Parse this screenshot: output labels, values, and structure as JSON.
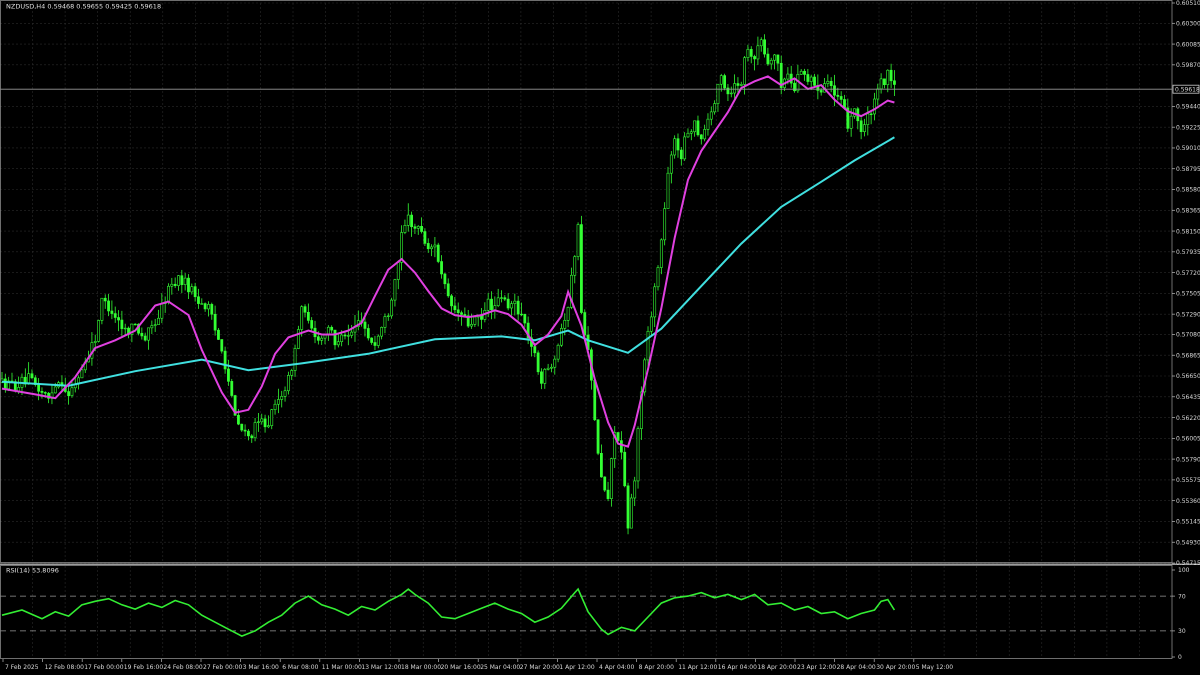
{
  "header": {
    "main_text": "NZDUSD,H4  0.59468 0.59655 0.59425 0.59618",
    "rsi_text": "RSI(14) 53.8096"
  },
  "colors": {
    "background": "#000000",
    "grid": "#2a2a2a",
    "frame": "#8a8a8a",
    "candle": "#33ff33",
    "ma_fast": "#e040e0",
    "ma_slow": "#40e0e0",
    "rsi_line": "#33ee33",
    "rsi_levels": "#9a9a9a"
  },
  "chart_data": [
    {
      "type": "candlestick",
      "symbol": "NZDUSD",
      "timeframe": "H4",
      "ohlc": {
        "open": 0.59468,
        "high": 0.59655,
        "low": 0.59425,
        "close": 0.59618
      },
      "current_price_label": "0.59618",
      "current_price": 0.59618,
      "ylim": [
        0.54715,
        0.6051
      ],
      "y_tick_labels": [
        "0.60510",
        "0.60300",
        "0.60085",
        "0.59870",
        "0.59618",
        "0.59440",
        "0.59225",
        "0.59010",
        "0.58795",
        "0.58580",
        "0.58365",
        "0.58150",
        "0.57935",
        "0.57720",
        "0.57505",
        "0.57290",
        "0.57080",
        "0.56865",
        "0.56650",
        "0.56435",
        "0.56220",
        "0.56005",
        "0.55790",
        "0.55575",
        "0.55360",
        "0.55145",
        "0.54930",
        "0.54715"
      ],
      "y_ticks": [
        0.6051,
        0.603,
        0.60085,
        0.5987,
        0.5944,
        0.59225,
        0.5901,
        0.58795,
        0.5858,
        0.58365,
        0.5815,
        0.57935,
        0.5772,
        0.57505,
        0.5729,
        0.5708,
        0.56865,
        0.5665,
        0.56435,
        0.5622,
        0.56005,
        0.5579,
        0.55575,
        0.5536,
        0.55145,
        0.5493,
        0.54715
      ],
      "x_tick_labels": [
        "7 Feb 2025",
        "12 Feb 08:00",
        "17 Feb 00:00",
        "19 Feb 16:00",
        "24 Feb 08:00",
        "27 Feb 00:00",
        "3 Mar 16:00",
        "6 Mar 08:00",
        "11 Mar 00:00",
        "13 Mar 12:00",
        "18 Mar 00:00",
        "20 Mar 16:00",
        "25 Mar 04:00",
        "27 Mar 20:00",
        "1 Apr 12:00",
        "4 Apr 04:00",
        "8 Apr 20:00",
        "11 Apr 12:00",
        "16 Apr 04:00",
        "18 Apr 20:00",
        "23 Apr 12:00",
        "28 Apr 04:00",
        "30 Apr 20:00",
        "5 May 12:00"
      ],
      "close_path": [
        [
          0,
          0.5658
        ],
        [
          4,
          0.5655
        ],
        [
          8,
          0.5662
        ],
        [
          12,
          0.5648
        ],
        [
          14,
          0.5641
        ],
        [
          16,
          0.5658
        ],
        [
          18,
          0.566
        ],
        [
          20,
          0.5643
        ],
        [
          24,
          0.5672
        ],
        [
          28,
          0.5705
        ],
        [
          30,
          0.5742
        ],
        [
          32,
          0.5738
        ],
        [
          34,
          0.5728
        ],
        [
          37,
          0.5712
        ],
        [
          40,
          0.5718
        ],
        [
          43,
          0.5704
        ],
        [
          47,
          0.5727
        ],
        [
          50,
          0.5755
        ],
        [
          53,
          0.5766
        ],
        [
          56,
          0.5758
        ],
        [
          59,
          0.5744
        ],
        [
          62,
          0.5735
        ],
        [
          64,
          0.5712
        ],
        [
          66,
          0.5696
        ],
        [
          68,
          0.566
        ],
        [
          70,
          0.5622
        ],
        [
          72,
          0.5608
        ],
        [
          74,
          0.5602
        ],
        [
          76,
          0.5611
        ],
        [
          78,
          0.5618
        ],
        [
          80,
          0.5618
        ],
        [
          82,
          0.5632
        ],
        [
          84,
          0.5648
        ],
        [
          86,
          0.566
        ],
        [
          88,
          0.5692
        ],
        [
          90,
          0.5736
        ],
        [
          92,
          0.5718
        ],
        [
          94,
          0.5708
        ],
        [
          96,
          0.5704
        ],
        [
          98,
          0.5718
        ],
        [
          100,
          0.5696
        ],
        [
          102,
          0.5713
        ],
        [
          104,
          0.5706
        ],
        [
          106,
          0.5715
        ],
        [
          108,
          0.5726
        ],
        [
          110,
          0.5705
        ],
        [
          112,
          0.5698
        ],
        [
          114,
          0.5715
        ],
        [
          116,
          0.5732
        ],
        [
          118,
          0.5766
        ],
        [
          120,
          0.5808
        ],
        [
          122,
          0.5829
        ],
        [
          124,
          0.5818
        ],
        [
          126,
          0.5816
        ],
        [
          128,
          0.5793
        ],
        [
          130,
          0.5804
        ],
        [
          132,
          0.5768
        ],
        [
          134,
          0.5743
        ],
        [
          136,
          0.5732
        ],
        [
          138,
          0.5728
        ],
        [
          140,
          0.5718
        ],
        [
          142,
          0.5724
        ],
        [
          144,
          0.5722
        ],
        [
          146,
          0.5742
        ],
        [
          148,
          0.5735
        ],
        [
          150,
          0.5748
        ],
        [
          152,
          0.5734
        ],
        [
          154,
          0.5742
        ],
        [
          156,
          0.5728
        ],
        [
          158,
          0.5708
        ],
        [
          160,
          0.5684
        ],
        [
          162,
          0.5662
        ],
        [
          164,
          0.5672
        ],
        [
          166,
          0.5688
        ],
        [
          168,
          0.5716
        ],
        [
          170,
          0.5738
        ],
        [
          172,
          0.5792
        ],
        [
          173,
          0.5822
        ],
        [
          174,
          0.5728
        ],
        [
          176,
          0.5698
        ],
        [
          178,
          0.5616
        ],
        [
          180,
          0.5558
        ],
        [
          182,
          0.5538
        ],
        [
          184,
          0.5612
        ],
        [
          186,
          0.5584
        ],
        [
          188,
          0.5508
        ],
        [
          190,
          0.5562
        ],
        [
          192,
          0.5652
        ],
        [
          194,
          0.5708
        ],
        [
          196,
          0.5756
        ],
        [
          198,
          0.5805
        ],
        [
          200,
          0.5872
        ],
        [
          202,
          0.5908
        ],
        [
          204,
          0.5895
        ],
        [
          206,
          0.5918
        ],
        [
          208,
          0.5928
        ],
        [
          210,
          0.5912
        ],
        [
          212,
          0.5932
        ],
        [
          214,
          0.5948
        ],
        [
          216,
          0.5975
        ],
        [
          218,
          0.5958
        ],
        [
          220,
          0.5966
        ],
        [
          222,
          0.5972
        ],
        [
          224,
          0.6008
        ],
        [
          226,
          0.5995
        ],
        [
          228,
          0.6012
        ],
        [
          230,
          0.5987
        ],
        [
          232,
          0.5998
        ],
        [
          234,
          0.5968
        ],
        [
          236,
          0.5976
        ],
        [
          238,
          0.5963
        ],
        [
          240,
          0.5986
        ],
        [
          242,
          0.5972
        ],
        [
          244,
          0.5968
        ],
        [
          246,
          0.5964
        ],
        [
          248,
          0.5976
        ],
        [
          250,
          0.5955
        ],
        [
          252,
          0.5946
        ],
        [
          254,
          0.5927
        ],
        [
          256,
          0.5944
        ],
        [
          258,
          0.5918
        ],
        [
          260,
          0.5931
        ],
        [
          262,
          0.5946
        ],
        [
          264,
          0.5968
        ],
        [
          266,
          0.5976
        ],
        [
          268,
          0.5962
        ]
      ],
      "ma_fast_path": [
        [
          0,
          0.5652
        ],
        [
          10,
          0.5646
        ],
        [
          16,
          0.5642
        ],
        [
          22,
          0.5664
        ],
        [
          28,
          0.5694
        ],
        [
          34,
          0.5702
        ],
        [
          40,
          0.5712
        ],
        [
          46,
          0.5738
        ],
        [
          50,
          0.5742
        ],
        [
          56,
          0.5728
        ],
        [
          60,
          0.5692
        ],
        [
          66,
          0.5648
        ],
        [
          70,
          0.5627
        ],
        [
          74,
          0.563
        ],
        [
          78,
          0.5654
        ],
        [
          82,
          0.5688
        ],
        [
          86,
          0.5705
        ],
        [
          92,
          0.5712
        ],
        [
          96,
          0.5708
        ],
        [
          100,
          0.5708
        ],
        [
          104,
          0.5712
        ],
        [
          108,
          0.572
        ],
        [
          112,
          0.5748
        ],
        [
          116,
          0.5775
        ],
        [
          120,
          0.5786
        ],
        [
          124,
          0.5772
        ],
        [
          128,
          0.5753
        ],
        [
          132,
          0.5735
        ],
        [
          136,
          0.5728
        ],
        [
          140,
          0.5726
        ],
        [
          144,
          0.5728
        ],
        [
          148,
          0.5733
        ],
        [
          152,
          0.5729
        ],
        [
          156,
          0.5718
        ],
        [
          160,
          0.5697
        ],
        [
          164,
          0.5708
        ],
        [
          168,
          0.5727
        ],
        [
          170,
          0.5752
        ],
        [
          174,
          0.5717
        ],
        [
          178,
          0.5662
        ],
        [
          182,
          0.5617
        ],
        [
          185,
          0.5595
        ],
        [
          188,
          0.5592
        ],
        [
          190,
          0.5614
        ],
        [
          194,
          0.5672
        ],
        [
          198,
          0.5735
        ],
        [
          202,
          0.5808
        ],
        [
          206,
          0.5868
        ],
        [
          210,
          0.5898
        ],
        [
          214,
          0.5918
        ],
        [
          218,
          0.5938
        ],
        [
          222,
          0.5963
        ],
        [
          226,
          0.597
        ],
        [
          230,
          0.5975
        ],
        [
          234,
          0.5966
        ],
        [
          238,
          0.5973
        ],
        [
          242,
          0.5962
        ],
        [
          246,
          0.5966
        ],
        [
          250,
          0.5951
        ],
        [
          254,
          0.5939
        ],
        [
          258,
          0.5934
        ],
        [
          262,
          0.5941
        ],
        [
          266,
          0.595
        ],
        [
          268,
          0.5948
        ]
      ],
      "ma_slow_path": [
        [
          0,
          0.5659
        ],
        [
          20,
          0.5655
        ],
        [
          40,
          0.567
        ],
        [
          60,
          0.5682
        ],
        [
          74,
          0.5671
        ],
        [
          90,
          0.5678
        ],
        [
          110,
          0.5688
        ],
        [
          130,
          0.5703
        ],
        [
          150,
          0.5706
        ],
        [
          160,
          0.5702
        ],
        [
          170,
          0.5712
        ],
        [
          176,
          0.5702
        ],
        [
          188,
          0.5689
        ],
        [
          198,
          0.5714
        ],
        [
          210,
          0.5758
        ],
        [
          222,
          0.5802
        ],
        [
          234,
          0.584
        ],
        [
          246,
          0.5866
        ],
        [
          256,
          0.5888
        ],
        [
          268,
          0.5912
        ]
      ]
    },
    {
      "type": "line",
      "name": "RSI(14)",
      "value": 53.8096,
      "ylim": [
        0,
        100
      ],
      "levels": [
        30,
        70
      ],
      "y_tick_labels": [
        "100",
        "70",
        "30",
        "0"
      ],
      "y_ticks": [
        100,
        70,
        30,
        0
      ],
      "path": [
        [
          0,
          48
        ],
        [
          6,
          54
        ],
        [
          12,
          44
        ],
        [
          16,
          52
        ],
        [
          20,
          47
        ],
        [
          24,
          60
        ],
        [
          28,
          64
        ],
        [
          32,
          67
        ],
        [
          36,
          60
        ],
        [
          40,
          55
        ],
        [
          44,
          62
        ],
        [
          48,
          57
        ],
        [
          52,
          65
        ],
        [
          56,
          60
        ],
        [
          60,
          48
        ],
        [
          64,
          40
        ],
        [
          68,
          32
        ],
        [
          72,
          24
        ],
        [
          76,
          30
        ],
        [
          80,
          40
        ],
        [
          84,
          48
        ],
        [
          88,
          62
        ],
        [
          92,
          70
        ],
        [
          96,
          60
        ],
        [
          100,
          55
        ],
        [
          104,
          48
        ],
        [
          108,
          58
        ],
        [
          112,
          54
        ],
        [
          116,
          64
        ],
        [
          120,
          72
        ],
        [
          122,
          78
        ],
        [
          124,
          72
        ],
        [
          128,
          62
        ],
        [
          132,
          46
        ],
        [
          136,
          44
        ],
        [
          140,
          50
        ],
        [
          144,
          56
        ],
        [
          148,
          62
        ],
        [
          152,
          55
        ],
        [
          156,
          50
        ],
        [
          160,
          40
        ],
        [
          164,
          46
        ],
        [
          168,
          56
        ],
        [
          172,
          74
        ],
        [
          173,
          78
        ],
        [
          176,
          52
        ],
        [
          180,
          32
        ],
        [
          182,
          26
        ],
        [
          186,
          34
        ],
        [
          190,
          30
        ],
        [
          194,
          46
        ],
        [
          198,
          62
        ],
        [
          202,
          68
        ],
        [
          206,
          70
        ],
        [
          210,
          74
        ],
        [
          214,
          68
        ],
        [
          218,
          72
        ],
        [
          222,
          66
        ],
        [
          226,
          72
        ],
        [
          230,
          60
        ],
        [
          234,
          62
        ],
        [
          238,
          54
        ],
        [
          242,
          58
        ],
        [
          246,
          50
        ],
        [
          250,
          52
        ],
        [
          254,
          44
        ],
        [
          258,
          50
        ],
        [
          262,
          54
        ],
        [
          264,
          64
        ],
        [
          266,
          66
        ],
        [
          268,
          54
        ]
      ]
    }
  ]
}
